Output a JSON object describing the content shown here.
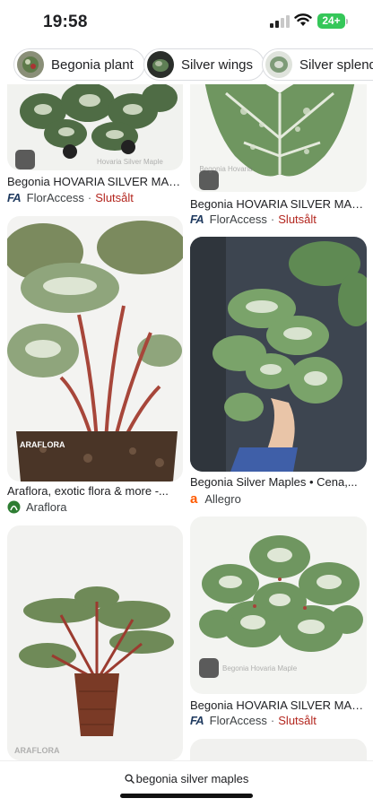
{
  "status": {
    "time": "19:58",
    "battery": "24+"
  },
  "chips": [
    {
      "label": "Begonia plant"
    },
    {
      "label": "Silver wings"
    },
    {
      "label": "Silver splendo"
    }
  ],
  "results": [
    {
      "title": "Begonia HOVARIA SILVER MAPLE",
      "source": "FlorAccess",
      "status": "Slutsålt",
      "watermark": "Hovaria Silver Maple"
    },
    {
      "title": "Begonia HOVARIA SILVER MAPLE",
      "source": "FlorAccess",
      "status": "Slutsålt",
      "watermark": "Begonia Hovaria"
    },
    {
      "title": "Araflora, exotic flora & more -...",
      "source": "Araflora",
      "watermark": "ARAFLORA"
    },
    {
      "title": "Begonia Silver Maples • Cena,...",
      "source": "Allegro"
    },
    {
      "title": "",
      "source": "",
      "watermark": "ARAFLORA"
    },
    {
      "title": "Begonia HOVARIA SILVER MAPLE",
      "source": "FlorAccess",
      "status": "Slutsålt",
      "watermark": "Begonia Hovaria Maple"
    }
  ],
  "source_icons": {
    "floraccess": "FA",
    "araflora": "araflora-logo-icon",
    "allegro": "a"
  },
  "colors": {
    "sold": "#b3261e",
    "battery": "#35c759",
    "leaf": "#6f8f5a",
    "stem": "#9b3b2f"
  },
  "bottom": {
    "query": "begonia silver maples"
  }
}
